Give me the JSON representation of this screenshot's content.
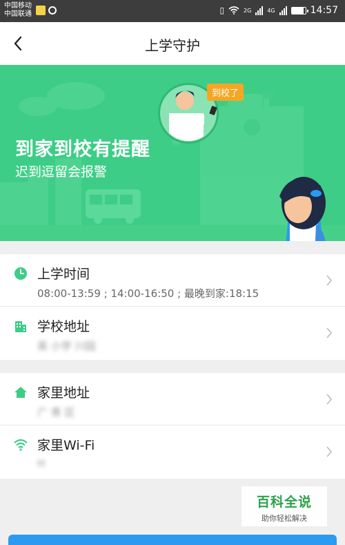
{
  "status_bar": {
    "carrier_1": "中国移动",
    "carrier_2": "中国联通",
    "net_1": "2G",
    "net_2": "4G",
    "time": "14:57",
    "battery_level": 0.85
  },
  "nav": {
    "title": "上学守护"
  },
  "banner": {
    "headline": "到家到校有提醒",
    "subline": "迟到逗留会报警",
    "bubble": "到校了"
  },
  "school_card": {
    "rows": [
      {
        "title": "上学时间",
        "subtitle": "08:00-13:59 ; 14:00-16:50 ; 最晚到家:18:15",
        "icon": "clock-icon"
      },
      {
        "title": "学校地址",
        "subtitle": "英   小学   川园",
        "icon": "building-icon"
      }
    ]
  },
  "home_card": {
    "rows": [
      {
        "title": "家里地址",
        "subtitle": "广   青   区",
        "icon": "home-icon"
      },
      {
        "title": "家里Wi-Fi",
        "subtitle": "   H",
        "icon": "wifi-icon"
      }
    ]
  },
  "watermark": {
    "title": "百科全说",
    "subtitle": "助你轻松解决"
  },
  "colors": {
    "accent_green": "#3dcd86",
    "button_blue": "#2a9bf0",
    "bubble_orange": "#f6a623"
  }
}
